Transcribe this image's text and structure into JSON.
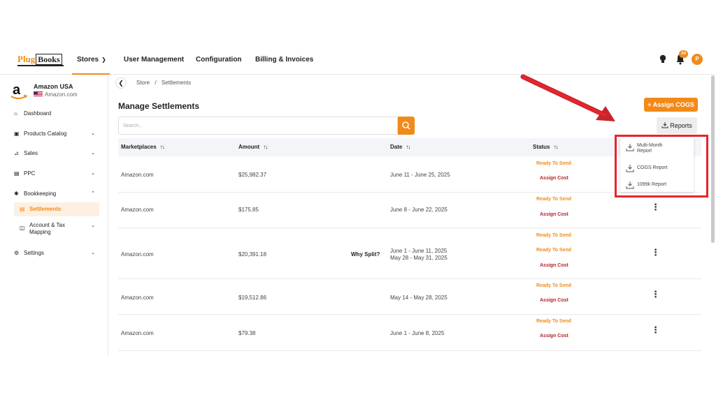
{
  "app": {
    "logo_part1": "Plug",
    "logo_part2": "Books"
  },
  "nav": {
    "stores": "Stores",
    "user_management": "User Management",
    "configuration": "Configuration",
    "billing": "Billing & Invoices",
    "notification_count": "34",
    "avatar_initial": "P"
  },
  "store": {
    "name": "Amazon USA",
    "domain": "Amazon.com"
  },
  "sidebar": {
    "items": [
      {
        "label": "Dashboard"
      },
      {
        "label": "Products Catalog"
      },
      {
        "label": "Sales"
      },
      {
        "label": "PPC"
      },
      {
        "label": "Bookkeeping"
      },
      {
        "label": "Settlements"
      },
      {
        "label": "Account & Tax"
      },
      {
        "label": "Mapping"
      },
      {
        "label": "Settings"
      }
    ]
  },
  "breadcrumb": {
    "store": "Store",
    "sep": "/",
    "current": "Settlements"
  },
  "page": {
    "title": "Manage Settlements",
    "assign_cogs": "+ Assign COGS",
    "reports": "Reports"
  },
  "search": {
    "placeholder": "Search..."
  },
  "table": {
    "headers": [
      "Marketplaces",
      "Amount",
      "Date",
      "Status"
    ],
    "rows": [
      {
        "marketplace": "Amazon.com",
        "amount": "$25,982.37",
        "date": "June 11 - June 25, 2025",
        "date2": "",
        "why": "",
        "ready": "Ready To Send",
        "ready2": "",
        "assign": "Assign Cost"
      },
      {
        "marketplace": "Amazon.com",
        "amount": "$175.85",
        "date": "June 8 - June 22, 2025",
        "date2": "",
        "why": "",
        "ready": "Ready To Send",
        "ready2": "",
        "assign": "Assign Cost"
      },
      {
        "marketplace": "Amazon.com",
        "amount": "$20,391.18",
        "date": "June 1 - June 11, 2025",
        "date2": "May 28 - May 31, 2025",
        "why": "Why Split?",
        "ready": "Ready To Send",
        "ready2": "Ready To Send",
        "assign": "Assign Cost"
      },
      {
        "marketplace": "Amazon.com",
        "amount": "$19,512.86",
        "date": "May 14 - May 28, 2025",
        "date2": "",
        "why": "",
        "ready": "Ready To Send",
        "ready2": "",
        "assign": "Assign Cost"
      },
      {
        "marketplace": "Amazon.com",
        "amount": "$79.38",
        "date": "June 1 - June 8, 2025",
        "date2": "",
        "why": "",
        "ready": "Ready To Send",
        "ready2": "",
        "assign": "Assign Cost"
      }
    ]
  },
  "reports_menu": {
    "items": [
      "Multi-Month",
      "Report",
      "COGS Report",
      "1099k Report"
    ]
  },
  "colors": {
    "accent": "#f28a1a",
    "assign_red": "#b4232a",
    "highlight_red": "#e8242c"
  }
}
